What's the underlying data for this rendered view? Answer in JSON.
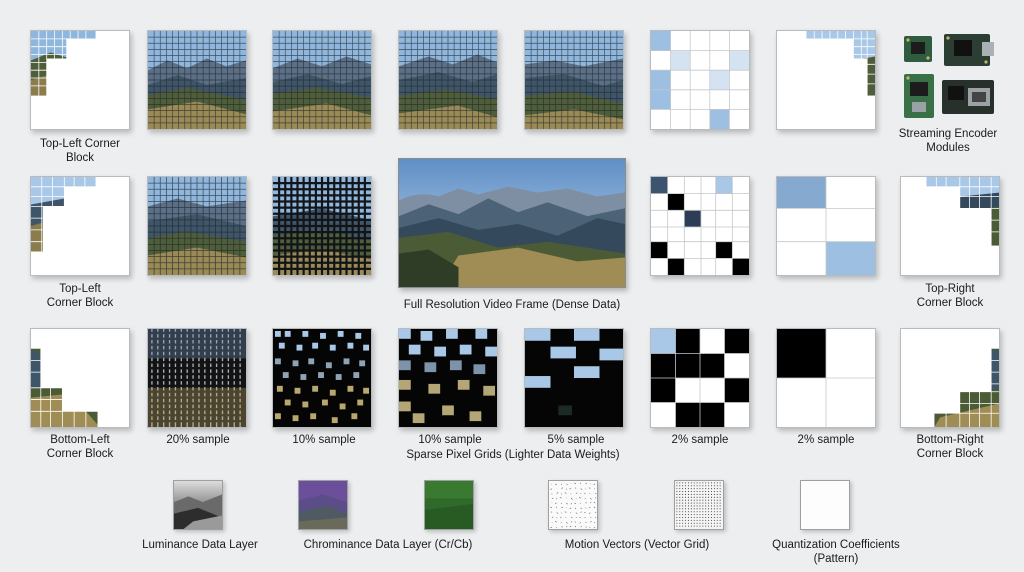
{
  "captions": {
    "top_left_corner_1": "Top-Left Corner\nBlock",
    "streaming_modules": "Streaming Encoder\nModules",
    "top_left_corner_2": "Top-Left\nCorner Block",
    "full_frame": "Full Resolution Video Frame (Dense Data)",
    "top_right_corner": "Top-Right\nCorner Block",
    "bottom_left_corner": "Bottom-Left\nCorner Block",
    "sample_20": "20% sample",
    "sample_10a": "10% sample",
    "sample_10b": "10% sample",
    "sparse_grids": "Sparse Pixel Grids (Lighter Data Weights)",
    "sample_5": "5% sample",
    "sample_2a": "2% sample",
    "sample_2b": "2% sample",
    "bottom_right_corner": "Bottom-Right\nCorner Block",
    "luminance": "Luminance Data Layer",
    "chrominance": "Chrominance Data Layer (Cr/Cb)",
    "motion": "Motion Vectors (Vector Grid)",
    "quantization": "Quantization Coefficients\n(Pattern)"
  },
  "colors": {
    "sky": "#8fb6dc",
    "mountain_far": "#5b6f86",
    "mountain_mid": "#3f5568",
    "hill_green": "#4f5e3a",
    "hill_gold": "#9a8a55",
    "block_blue": "#a9c7e6",
    "black": "#000000"
  }
}
